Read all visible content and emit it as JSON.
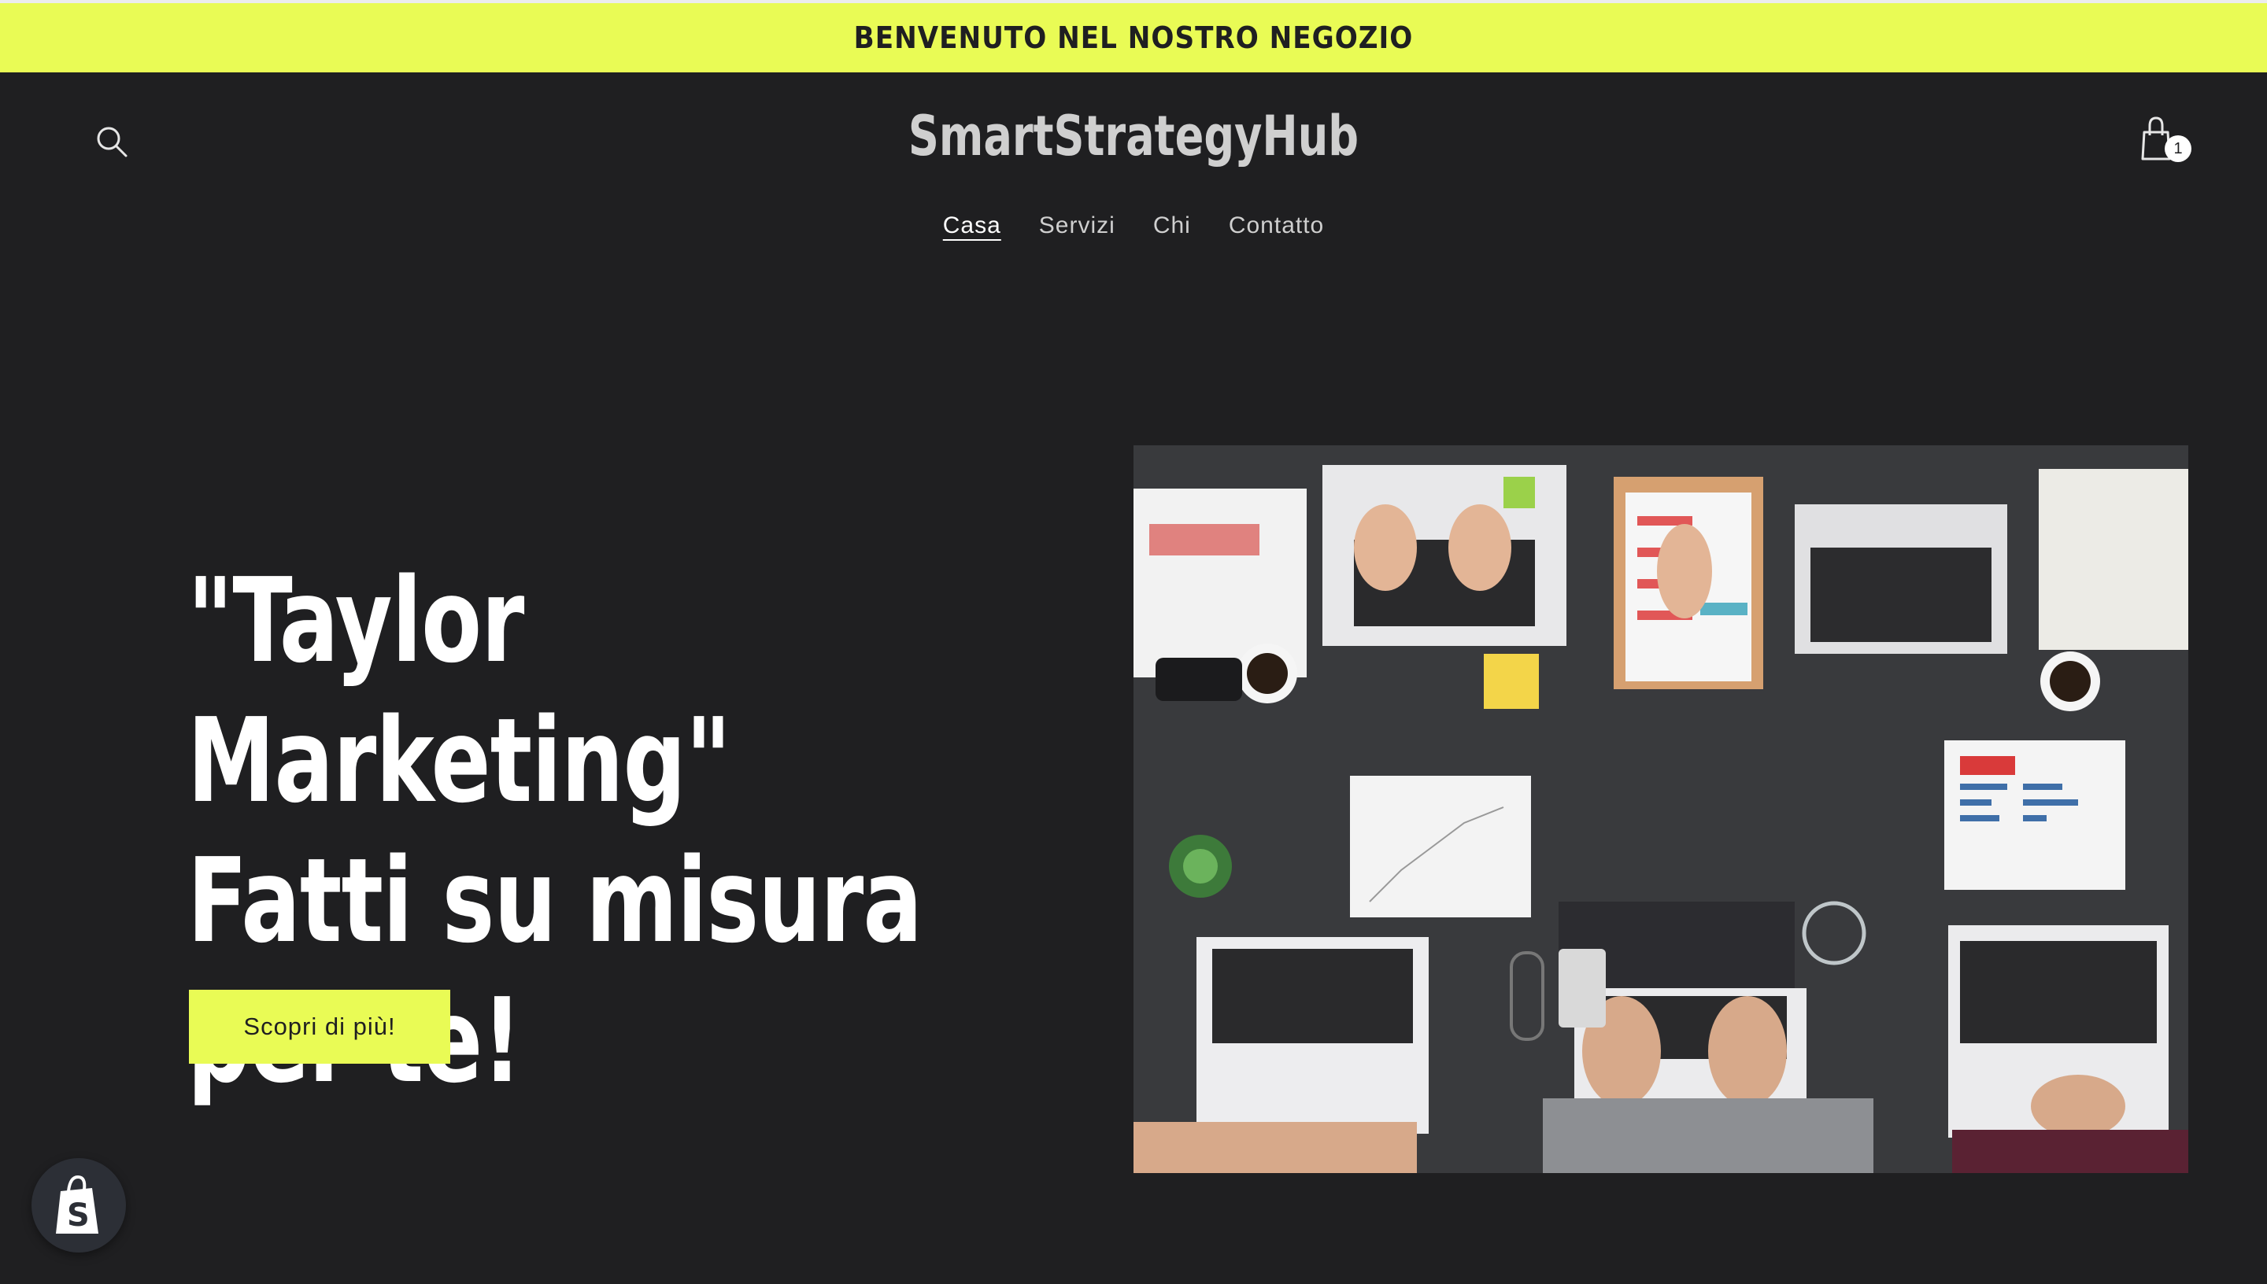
{
  "announcement": {
    "text": "BENVENUTO NEL NOSTRO NEGOZIO"
  },
  "header": {
    "logo": "SmartStrategyHub",
    "cart_count": "1",
    "nav": [
      {
        "label": "Casa",
        "active": true
      },
      {
        "label": "Servizi",
        "active": false
      },
      {
        "label": "Chi",
        "active": false
      },
      {
        "label": "Contatto",
        "active": false
      }
    ]
  },
  "hero": {
    "title": "\"Taylor Marketing\" Fatti su misura per te!",
    "cta_label": "Scopri di più!"
  },
  "colors": {
    "accent": "#e9fb55",
    "background": "#1f1f21",
    "text": "#ffffff"
  },
  "icons": {
    "search": "search-icon",
    "cart": "cart-icon",
    "shopify": "shopify-bag-icon"
  }
}
